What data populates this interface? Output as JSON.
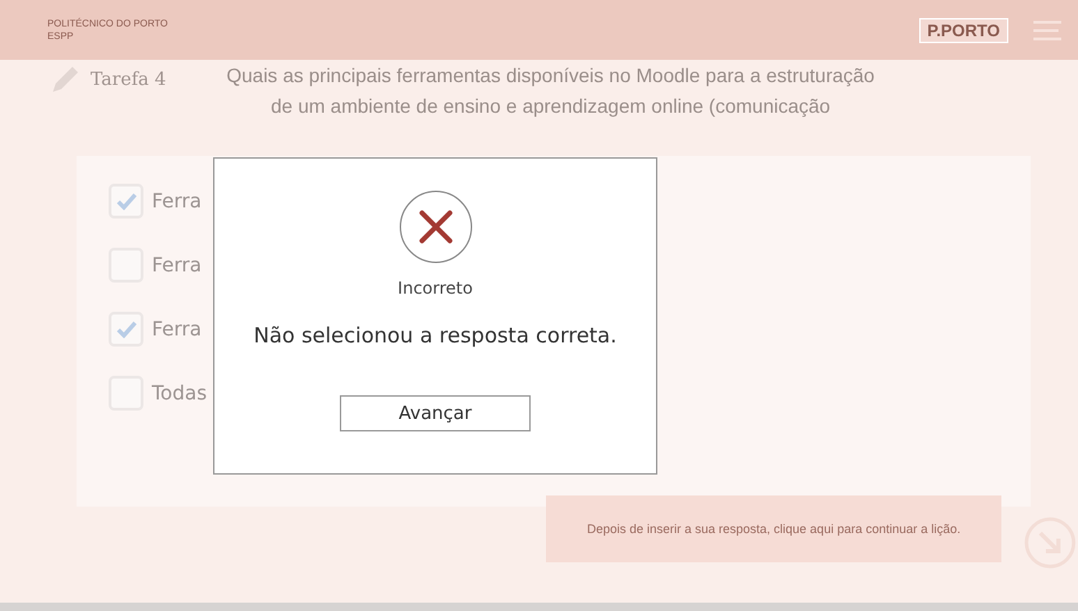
{
  "header": {
    "institution": "POLITÉCNICO DO PORTO",
    "school": "ESPP",
    "brand": "P.PORTO"
  },
  "task": {
    "label": "Tarefa 4",
    "question_lines": [
      "Quais as principais ferramentas disponíveis no Moodle para a estruturação",
      "de um ambiente de ensino e aprendizagem online (comunicação"
    ]
  },
  "options": [
    {
      "label": "Ferra",
      "checked": true
    },
    {
      "label": "Ferra",
      "checked": false
    },
    {
      "label": "Ferra",
      "checked": true
    },
    {
      "label": "Todas",
      "checked": false
    }
  ],
  "footer_hint": "Depois de inserir a sua resposta, clique aqui para continuar a lição.",
  "dialog": {
    "status": "Incorreto",
    "message": "Não selecionou a resposta correta.",
    "button": "Avançar"
  }
}
